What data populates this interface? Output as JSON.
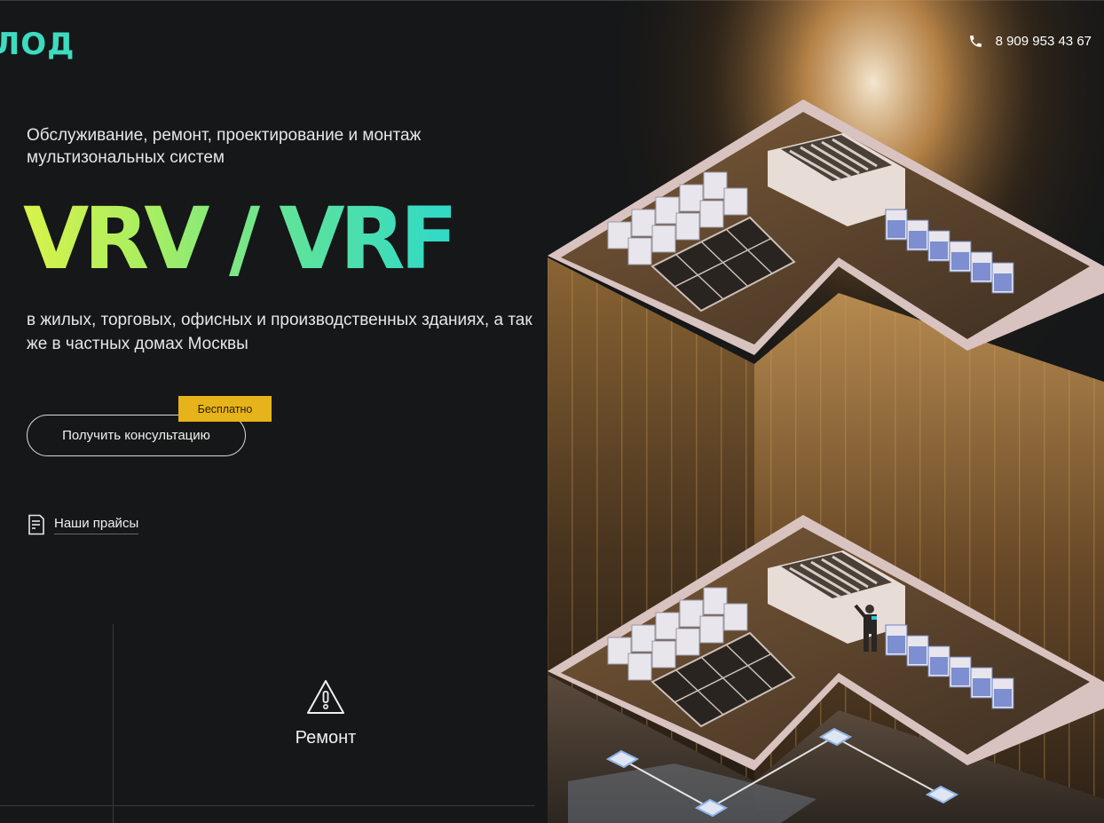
{
  "header": {
    "logo_text": "ЛОД",
    "phone": "8 909 953 43 67",
    "phone_icon": "phone-icon"
  },
  "hero": {
    "subtitle": "Обслуживание, ремонт, проектирование и монтаж мультизональных систем",
    "title": "VRV / VRF",
    "description": "в жилых, торговых, офисных и  производственных зданиях, а так же в  частных домах Москвы",
    "cta_label": "Получить консультацию",
    "badge": "Бесплатно",
    "prices_link": "Наши прайсы",
    "prices_icon": "price-list-icon",
    "title_gradient": [
      "#d9f24a",
      "#a6ee62",
      "#5fe39a",
      "#2fd9c9"
    ],
    "badge_color": "#e7b31a"
  },
  "services": {
    "items": [
      {
        "label": "Ремонт",
        "icon": "warning-triangle-icon"
      }
    ]
  },
  "illustration": {
    "subject": "isometric-building-illustration"
  }
}
